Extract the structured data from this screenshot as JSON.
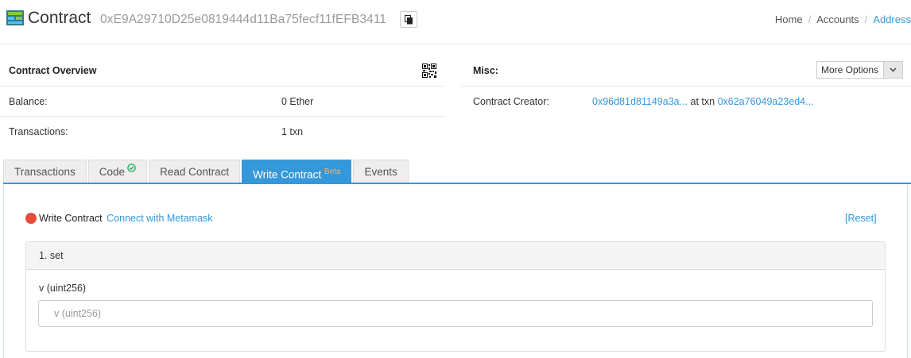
{
  "header": {
    "title": "Contract",
    "address": "0xE9A29710D25e0819444d11Ba75fecf11fEFB3411",
    "breadcrumbs": [
      "Home",
      "Accounts",
      "Address"
    ]
  },
  "overview": {
    "title": "Contract Overview",
    "rows": [
      {
        "label": "Balance:",
        "value": "0 Ether"
      },
      {
        "label": "Transactions:",
        "value": "1 txn"
      }
    ]
  },
  "misc": {
    "title": "Misc:",
    "more_options_label": "More Options",
    "creator_label": "Contract Creator:",
    "creator_address": "0x96d81d81149a3a...",
    "at_txn_text": "at txn",
    "creator_txn": "0x62a76049a23ed4..."
  },
  "tabs": [
    {
      "label": "Transactions",
      "active": false
    },
    {
      "label": "Code",
      "active": false
    },
    {
      "label": "Read Contract",
      "active": false
    },
    {
      "label": "Write Contract",
      "badge": "Beta",
      "active": true
    },
    {
      "label": "Events",
      "active": false
    }
  ],
  "write": {
    "status_label": "Write Contract",
    "connect_link": "Connect with Metamask",
    "reset_label": "[Reset]",
    "functions": [
      {
        "title": "1. set",
        "param_label": "v (uint256)",
        "input_placeholder": "v (uint256)",
        "input_value": ""
      }
    ]
  },
  "colors": {
    "accent": "#3498db",
    "status_dot": "#e74c3c",
    "code_verified": "#27ae60",
    "beta": "#f6b26b"
  },
  "icons": [
    "contract-logo-icon",
    "copy-icon",
    "qr-code-icon",
    "chevron-down-icon",
    "verified-check-icon",
    "status-dot-icon"
  ]
}
